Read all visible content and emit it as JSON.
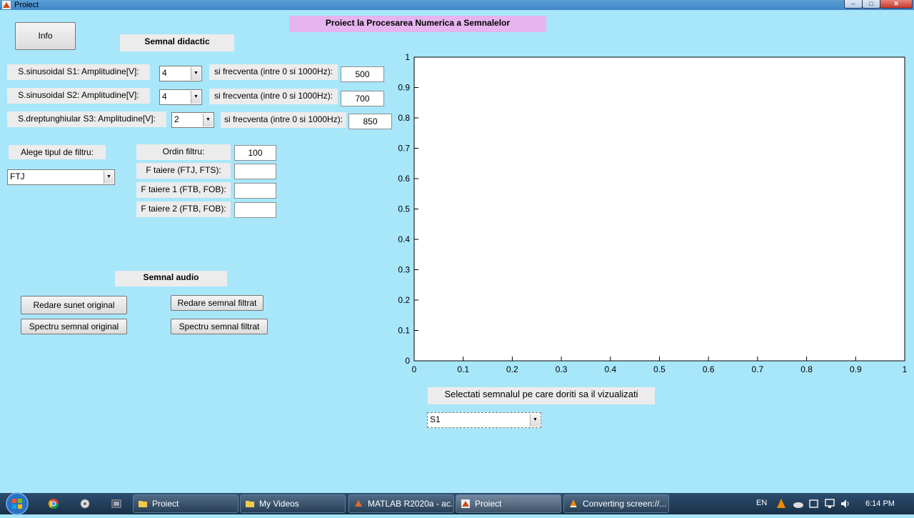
{
  "window": {
    "title": "Proiect",
    "min": "–",
    "max": "□",
    "close": "✕"
  },
  "header": {
    "title": "Proiect la Procesarea Numerica a Semnalelor"
  },
  "info_button": "Info",
  "didactic": {
    "title": "Semnal didactic",
    "rows": [
      {
        "label": "S.sinusoidal S1:  Amplitudine[V]:",
        "amplitude": "4",
        "freq_label": "si frecventa (intre 0 si 1000Hz):",
        "freq": "500"
      },
      {
        "label": "S.sinusoidal S2:  Amplitudine[V]:",
        "amplitude": "4",
        "freq_label": "si frecventa (intre 0 si 1000Hz):",
        "freq": "700"
      },
      {
        "label": "S.dreptunghiular S3:  Amplitudine[V]:",
        "amplitude": "2",
        "freq_label": "si frecventa (intre 0 si 1000Hz):",
        "freq": "850"
      }
    ]
  },
  "filter": {
    "type_label": "Alege tipul de filtru:",
    "type_value": "FTJ",
    "order_label": "Ordin filtru:",
    "order_value": "100",
    "fc_label": "F taiere (FTJ, FTS):",
    "fc_value": "",
    "fc1_label": "F taiere 1 (FTB, FOB):",
    "fc1_value": "",
    "fc2_label": "F taiere 2 (FTB, FOB):",
    "fc2_value": ""
  },
  "audio": {
    "title": "Semnal audio",
    "play_original": "Redare sunet original",
    "play_filtered": "Redare semnal filtrat",
    "spectrum_original": "Spectru semnal original",
    "spectrum_filtered": "Spectru semnal filtrat"
  },
  "chart_data": {
    "type": "line",
    "series": [],
    "xlim": [
      0,
      1
    ],
    "ylim": [
      0,
      1
    ],
    "x_ticks": [
      "0",
      "0.1",
      "0.2",
      "0.3",
      "0.4",
      "0.5",
      "0.6",
      "0.7",
      "0.8",
      "0.9",
      "1"
    ],
    "y_ticks": [
      "0",
      "0.1",
      "0.2",
      "0.3",
      "0.4",
      "0.5",
      "0.6",
      "0.7",
      "0.8",
      "0.9",
      "1"
    ],
    "grid": false
  },
  "signal_select": {
    "label": "Selectati semnalul pe care doriti sa il vizualizati",
    "value": "S1"
  },
  "taskbar": {
    "items": [
      {
        "label": "Proiect",
        "icon": "folder-icon"
      },
      {
        "label": "My Videos",
        "icon": "folder-icon"
      },
      {
        "label": "MATLAB R2020a - ac...",
        "icon": "matlab-icon"
      },
      {
        "label": "Proiect",
        "icon": "matlab-figure-icon"
      },
      {
        "label": "Converting screen://...",
        "icon": "vlc-icon"
      }
    ],
    "lang": "EN",
    "time": "6:14 PM"
  }
}
